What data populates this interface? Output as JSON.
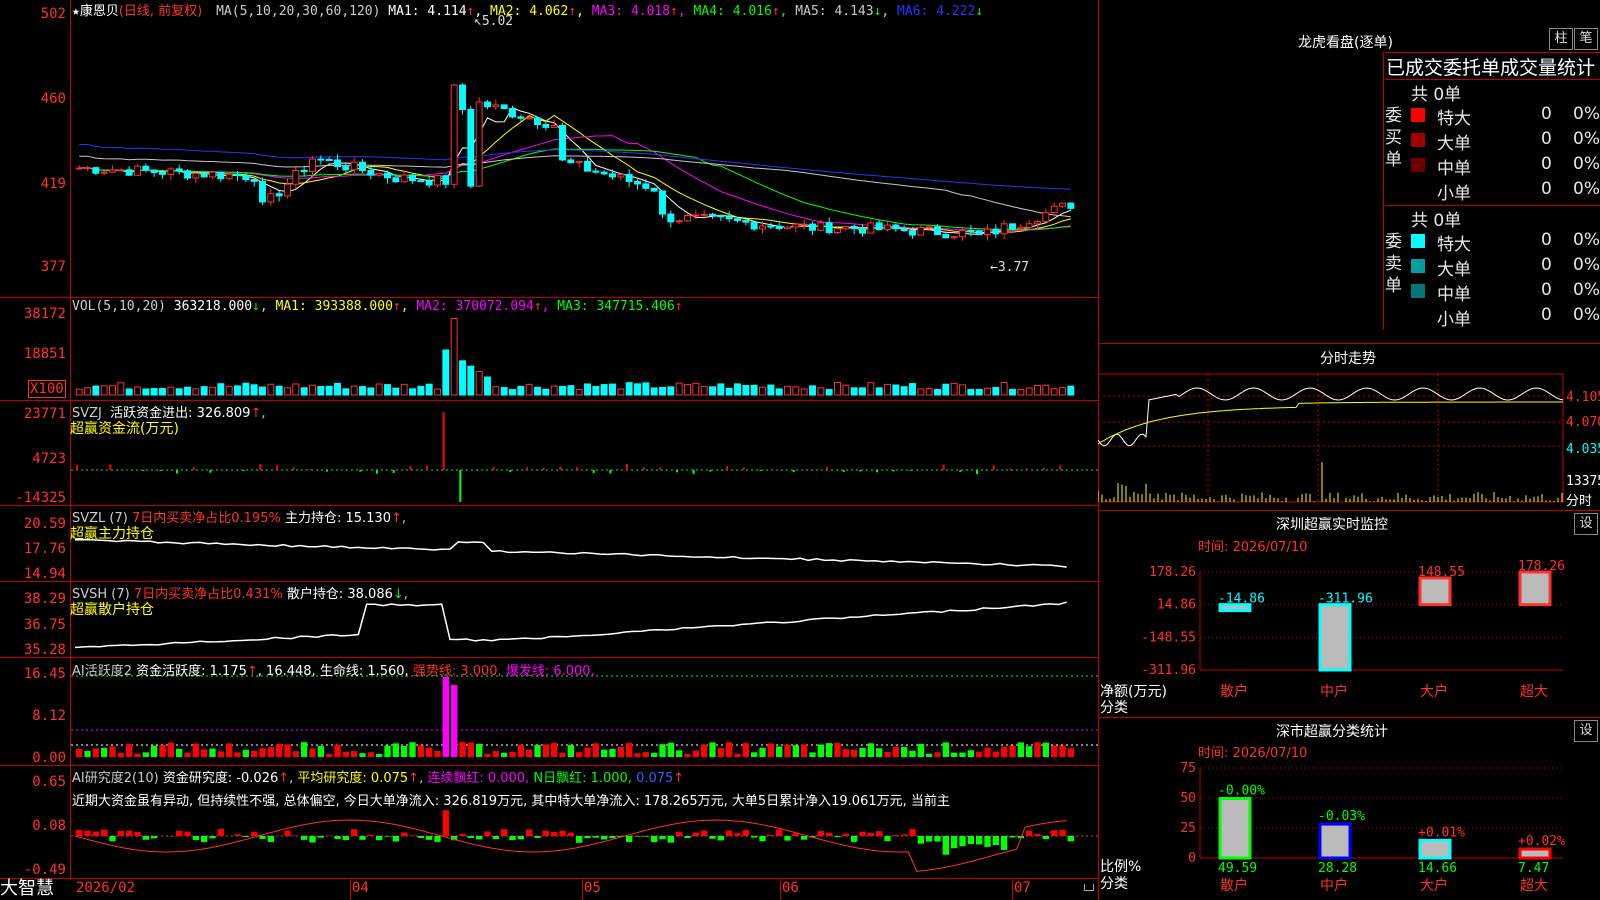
{
  "stock": {
    "name": "康恩贝",
    "period": "(日线, 前复权)",
    "star": "★"
  },
  "main": {
    "ma_label": "MA(5,10,20,30,60,120)",
    "ma": [
      {
        "name": "MA1",
        "value": "4.114",
        "arrow": "↑",
        "color": "#ffffff"
      },
      {
        "name": "MA2",
        "value": "4.062",
        "arrow": "↑",
        "color": "#ffff00"
      },
      {
        "name": "MA3",
        "value": "4.018",
        "arrow": "↑",
        "color": "#ff00ff"
      },
      {
        "name": "MA4",
        "value": "4.016",
        "arrow": "↑",
        "color": "#00ff00"
      },
      {
        "name": "MA5",
        "value": "4.143",
        "arrow": "↓",
        "color": "#c8c8c8"
      },
      {
        "name": "MA6",
        "value": "4.222",
        "arrow": "↓",
        "color": "#3030ff"
      }
    ],
    "y_ticks": [
      "502",
      "460",
      "419",
      "377"
    ],
    "high_mark": "5.02",
    "low_mark": "3.77"
  },
  "vol": {
    "label": "VOL(5,10,20)",
    "value": "363218.000",
    "ma": [
      {
        "name": "MA1",
        "value": "393388.000",
        "arrow": "↑",
        "color": "#ffff00"
      },
      {
        "name": "MA2",
        "value": "370072.094",
        "arrow": "↑",
        "color": "#ff00ff"
      },
      {
        "name": "MA3",
        "value": "347715.406",
        "arrow": "↑",
        "color": "#00ff00"
      }
    ],
    "y_ticks": [
      "38172",
      "18851"
    ],
    "unit": "X100"
  },
  "svzj": {
    "title": "SVZJ",
    "item": "活跃资金进出: 326.809",
    "arrow": "↑",
    "suffix": ",",
    "sub": "超赢资金流(万元)",
    "y_ticks": [
      "23771",
      "4723",
      "-14325"
    ]
  },
  "svzl": {
    "title": "SVZL (7)",
    "ratio": "7日内买卖净占比0.195%",
    "item": "主力持仓: 15.130",
    "arrow": "↑",
    "suffix": ",",
    "sub": "超赢主力持仓",
    "y_ticks": [
      "20.59",
      "17.76",
      "14.94"
    ]
  },
  "svsh": {
    "title": "SVSH (7)",
    "ratio": "7日内买卖净占比0.431%",
    "item": "散户持仓: 38.086",
    "arrow": "↓",
    "suffix": ",",
    "sub": "超赢散户持仓",
    "y_ticks": [
      "38.29",
      "36.75",
      "35.28"
    ]
  },
  "ai1": {
    "title": "AI活跃度2",
    "item1": "资金活跃度: 1.175",
    "a1": "↑",
    "item2": ", 16.448,",
    "item3": "生命线: 1.560,",
    "item4": "强势线: 3.000,",
    "item5": "爆发线: 6.000,",
    "y_ticks": [
      "16.45",
      "8.12",
      "0.00"
    ]
  },
  "ai2": {
    "title": "AI研究度2(10)",
    "item1": "资金研究度: -0.026",
    "a1": "↑",
    "item2": "平均研究度: 0.075",
    "a2": "↑",
    "item3": "连续飘红: 0.000,",
    "item4": "N日飘红: 1.000,",
    "item5": "0.075",
    "a5": "↑",
    "desc": "近期大资金虽有异动, 但持续性不强, 总体偏空, 今日大单净流入: 326.819万元, 其中特大单净流入: 178.265万元, 大单5日累计净入19.061万元, 当前主",
    "y_ticks": [
      "0.65",
      "0.08",
      "-0.49"
    ]
  },
  "xaxis": {
    "brand": "大智慧",
    "labels": [
      "2026/02",
      "04",
      "05",
      "06",
      "07"
    ]
  },
  "dragon": {
    "title": "龙虎看盘(逐单)",
    "btn_bar": "柱",
    "btn_pen": "笔",
    "table_title": "已成交委托单成交量统计",
    "buy": {
      "side_label": "委买单",
      "total": "共 0单",
      "rows": [
        {
          "label": "特大",
          "value": "0",
          "pct": "0%",
          "color": "#ff0000"
        },
        {
          "label": "大单",
          "value": "0",
          "pct": "0%",
          "color": "#a00000"
        },
        {
          "label": "中单",
          "value": "0",
          "pct": "0%",
          "color": "#700000"
        },
        {
          "label": "小单",
          "value": "0",
          "pct": "0%",
          "color": "#000000"
        }
      ]
    },
    "sell": {
      "side_label": "委卖单",
      "total": "共 0单",
      "rows": [
        {
          "label": "特大",
          "value": "0",
          "pct": "0%",
          "color": "#00ffff"
        },
        {
          "label": "大单",
          "value": "0",
          "pct": "0%",
          "color": "#00a0a0"
        },
        {
          "label": "中单",
          "value": "0",
          "pct": "0%",
          "color": "#007878"
        },
        {
          "label": "小单",
          "value": "0",
          "pct": "0%",
          "color": "#000000"
        }
      ]
    }
  },
  "intraday": {
    "title": "分时走势",
    "prices": [
      "4.105",
      "4.070",
      "4.035"
    ],
    "vol": "13375",
    "vol_unit": "分时"
  },
  "sz_monitor": {
    "title": "深圳超赢实时监控",
    "btn": "设",
    "time": "时间: 2026/07/10",
    "y_ticks": [
      "178.26",
      "14.86",
      "-148.55",
      "-311.96"
    ],
    "ylabel": "净额(万元)",
    "xlabel": "分类",
    "categories": [
      "散户",
      "中户",
      "大户",
      "超大"
    ],
    "values": [
      -14.86,
      -311.96,
      148.55,
      178.26
    ],
    "labels": [
      "-14.86",
      "-311.96",
      "148.55",
      "178.26"
    ]
  },
  "sz_class": {
    "title": "深市超赢分类统计",
    "btn": "设",
    "time": "时间: 2026/07/10",
    "y_ticks": [
      "75",
      "50",
      "25",
      "0"
    ],
    "ylabel": "比例%",
    "xlabel": "分类",
    "categories": [
      "散户",
      "中户",
      "大户",
      "超大"
    ],
    "values": [
      49.59,
      28.28,
      14.66,
      7.47
    ],
    "labels": [
      "49.59",
      "28.28",
      "14.66",
      "7.47"
    ],
    "changes": [
      "-0.00%",
      "-0.03%",
      "+0.01%",
      "+0.02%"
    ]
  },
  "chart_data": [
    {
      "type": "bar",
      "title": "深圳超赢实时监控",
      "categories": [
        "散户",
        "中户",
        "大户",
        "超大"
      ],
      "values": [
        -14.86,
        -311.96,
        148.55,
        178.26
      ],
      "ylabel": "净额(万元)",
      "xlabel": "分类",
      "ylim": [
        -311.96,
        178.26
      ]
    },
    {
      "type": "bar",
      "title": "深市超赢分类统计",
      "categories": [
        "散户",
        "中户",
        "大户",
        "超大"
      ],
      "values": [
        49.59,
        28.28,
        14.66,
        7.47
      ],
      "ylabel": "比例%",
      "xlabel": "分类",
      "ylim": [
        0,
        75
      ]
    }
  ]
}
